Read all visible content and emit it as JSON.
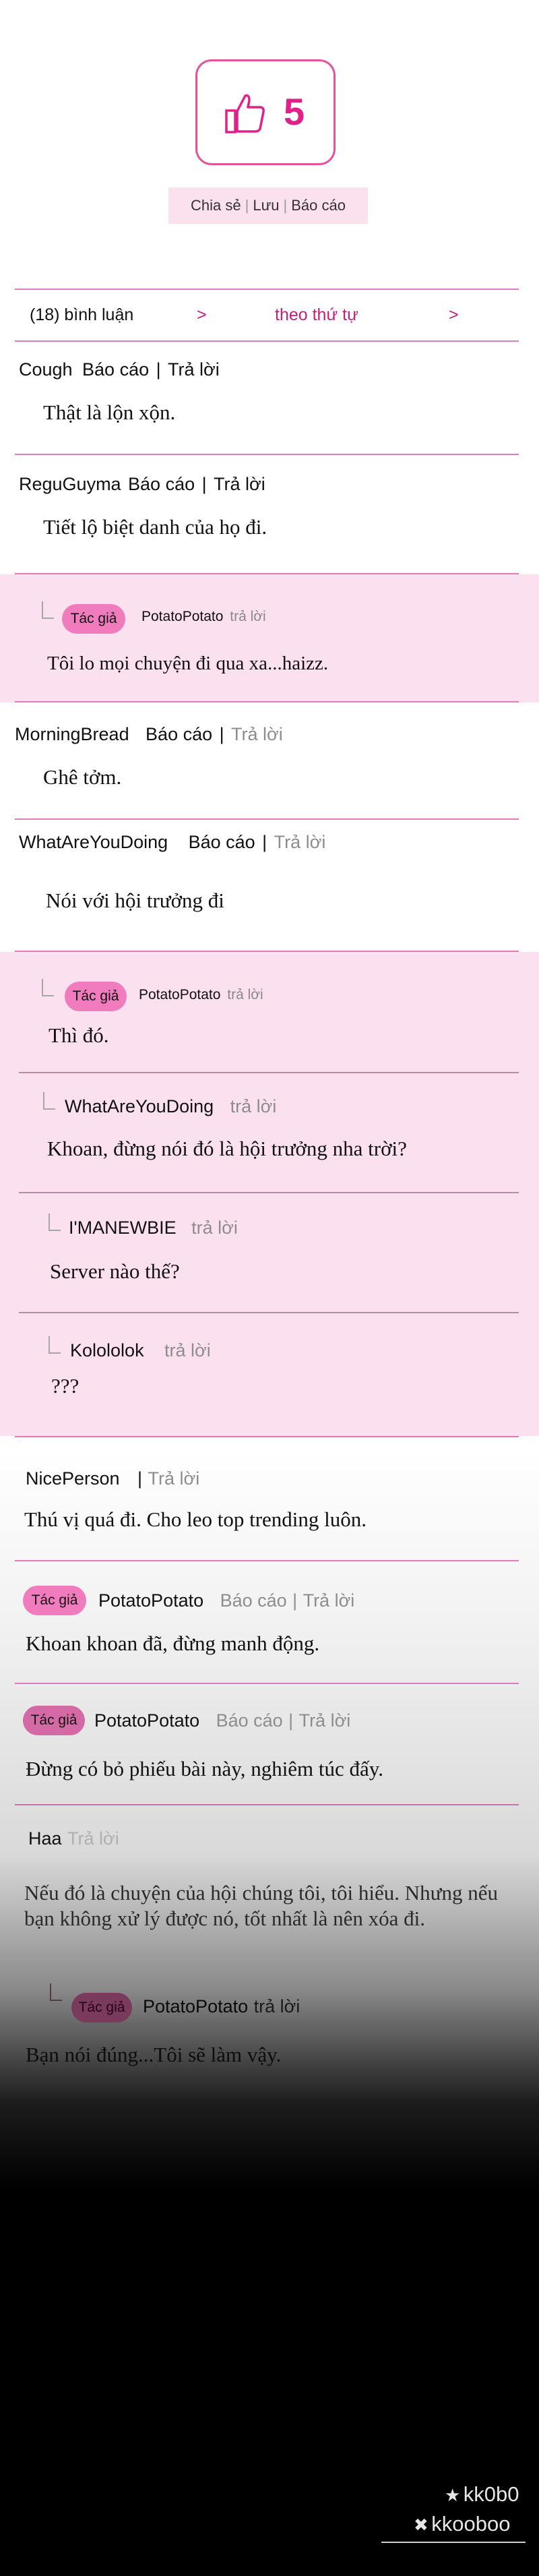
{
  "like": {
    "count": "5",
    "icon": "thumbs-up-icon",
    "accent": "#e0218a"
  },
  "share_bar": {
    "share": "Chia sẻ",
    "save": "Lưu",
    "report": "Báo cáo",
    "sep": "|"
  },
  "comment_bar": {
    "count_label": "(18) bình luận",
    "arrow": ">",
    "sort_label": "theo thứ tự"
  },
  "comments": [
    {
      "user": "Cough",
      "report": "Báo cáo",
      "sep": "|",
      "reply": "Trả lời",
      "text": "Thật là lộn xộn."
    },
    {
      "user": "ReguGuyma",
      "report": "Báo cáo",
      "sep": "|",
      "reply": "Trả lời",
      "text": "Tiết lộ biệt danh của họ đi."
    },
    {
      "tag": "Tác giả",
      "user": "PotatoPotato",
      "reply": "trả lời",
      "text": "Tôi lo mọi chuyện đi qua xa...haizz."
    },
    {
      "user": "MorningBread",
      "report": "Báo cáo",
      "sep": "|",
      "reply": "Trả lời",
      "text": "Ghê tởm."
    },
    {
      "user": "WhatAreYouDoing",
      "report": "Báo cáo",
      "sep": "|",
      "reply": "Trả lời",
      "text": "Nói với hội trưởng đi"
    },
    {
      "tag": "Tác giả",
      "user": "PotatoPotato",
      "reply": "trả lời",
      "text": "Thì đó."
    },
    {
      "user": "WhatAreYouDoing",
      "reply": "trả lời",
      "text": "Khoan, đừng nói đó là hội trưởng nha trời?"
    },
    {
      "user": "I'MANEWBIE",
      "reply": "trả lời",
      "text": "Server nào thế?"
    },
    {
      "user": "Kolololok",
      "reply": "trả lời",
      "text": "???"
    },
    {
      "user": "NicePerson",
      "sep": "|",
      "reply": "Trả lời",
      "text": "Thú vị quá đi. Cho leo top trending luôn."
    },
    {
      "tag": "Tác giả",
      "user": "PotatoPotato",
      "report": "Báo cáo",
      "sep": "|",
      "reply": "Trả lời",
      "text": "Khoan khoan đã, đừng manh động."
    },
    {
      "tag": "Tác giả",
      "user": "PotatoPotato",
      "report": "Báo cáo",
      "sep": "|",
      "reply": "Trả lời",
      "text": "Đừng có bỏ phiếu bài này, nghiêm túc đấy."
    },
    {
      "user": "Haa",
      "reply": "Trả lời",
      "text_line1": "Nếu đó là chuyện của hội chúng tôi, tôi hiểu. Nhưng nếu",
      "text_line2": "bạn không xử lý được nó, tốt nhất là nên xóa đi."
    },
    {
      "tag": "Tác giả",
      "user": "PotatoPotato",
      "reply": "trả lời",
      "text": "Bạn nói đúng...Tôi sẽ làm vậy."
    }
  ],
  "watermark": {
    "line1": "kk0b0",
    "line2": "kkooboo",
    "star_icon": "star-icon",
    "cross_icon": "cross-icon"
  }
}
